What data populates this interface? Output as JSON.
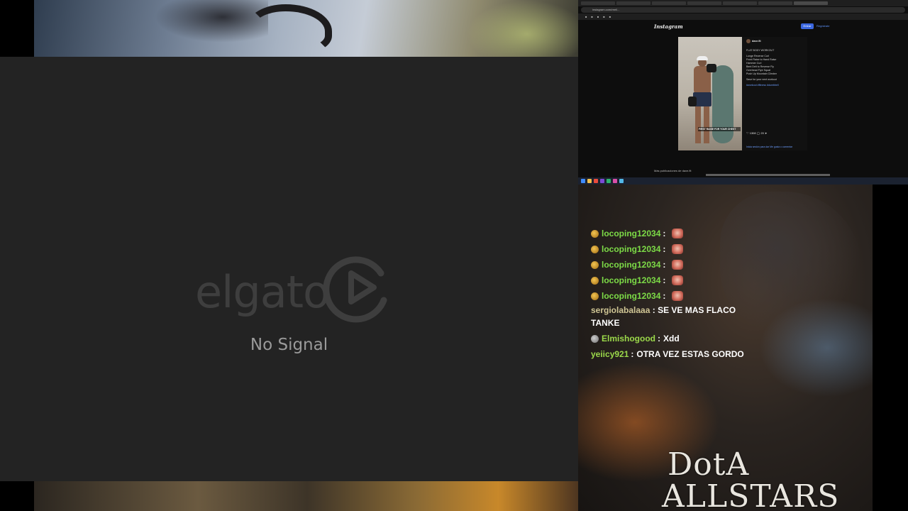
{
  "elgato": {
    "brand": "elgato",
    "status": "No Signal"
  },
  "browser": {
    "tabs": [
      "",
      "",
      "",
      "",
      "",
      "",
      ""
    ],
    "url": "instagram.com/reel/...",
    "bookmarks": [
      "",
      "",
      "",
      "",
      "",
      ""
    ]
  },
  "instagram": {
    "logo": "Instagram",
    "login_label": "Entrar",
    "signup_label": "Regístrate",
    "post": {
      "username": "dave.fit",
      "photo_caption": "FIRST RAISE FOR YOUR CHEST",
      "caption_title": "FLAT BODY WORKOUT",
      "caption_lines": [
        "Lunge Reverse Curl",
        "Front Raise to Hand Raise",
        "Hammer Curl",
        "Bent Delt to Reverse Fly",
        "Overhead Flye Squat",
        "Push Up Mountain Climber"
      ],
      "cta": "Save for your next workout",
      "hashtags": "#workout #fitness #dumbbell",
      "likes": "1308",
      "comments": "20",
      "comment_prompt": "Inicia sesión para dar Me gusta o comentar"
    },
    "more_posts": "Más publicaciones de dave.fit"
  },
  "chat": {
    "messages": [
      {
        "user": "locoping12034",
        "text": "",
        "badge": "gold",
        "emote": true
      },
      {
        "user": "locoping12034",
        "text": "",
        "badge": "gold",
        "emote": true
      },
      {
        "user": "locoping12034",
        "text": "",
        "badge": "gold",
        "emote": true
      },
      {
        "user": "locoping12034",
        "text": "",
        "badge": "gold",
        "emote": true
      },
      {
        "user": "locoping12034",
        "text": "",
        "badge": "gold",
        "emote": true
      },
      {
        "user": "sergiolabalaaa",
        "text": "SE VE MAS FLACO TANKE",
        "badge": "none",
        "emote": false
      },
      {
        "user": "Elmishogood",
        "text": "Xdd",
        "badge": "gray",
        "emote": false
      },
      {
        "user": "yeiicy921",
        "text": "OTRA VEZ ESTAS GORDO",
        "badge": "none",
        "emote": false
      }
    ]
  },
  "game_logo": {
    "line1": "DotA",
    "line2": "ALLSTARS"
  },
  "colors": {
    "elgato_bg": "#232323",
    "chat_green": "#7ddc47",
    "chat_olive": "#cfc594",
    "instagram_blue": "#3b67e0"
  }
}
